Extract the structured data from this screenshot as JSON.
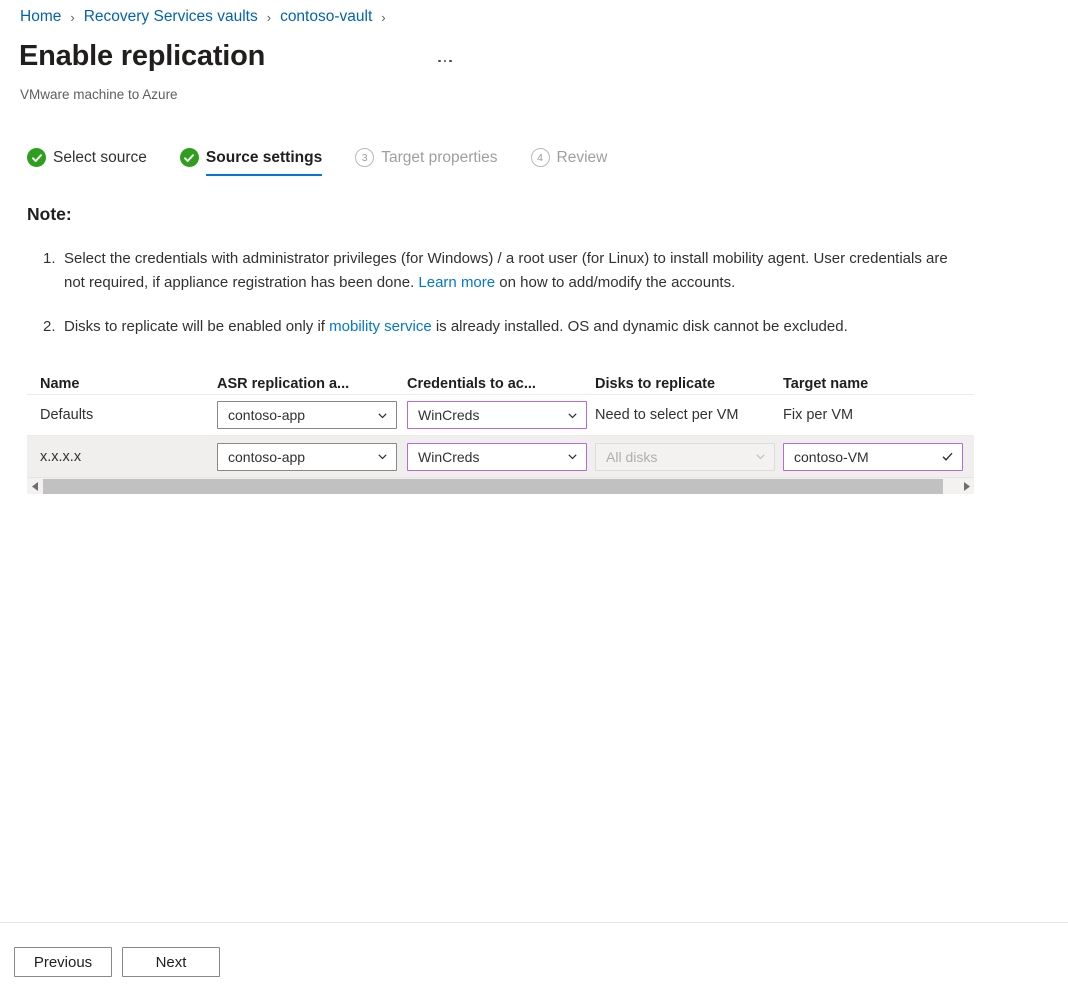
{
  "breadcrumb": {
    "items": [
      {
        "label": "Home"
      },
      {
        "label": "Recovery Services vaults"
      },
      {
        "label": "contoso-vault"
      }
    ],
    "separator": "›"
  },
  "header": {
    "title": "Enable replication",
    "subtitle": "VMware machine to Azure",
    "more_menu": "..."
  },
  "steps": [
    {
      "label": "Select source",
      "state": "done",
      "number": "1"
    },
    {
      "label": "Source settings",
      "state": "active",
      "number": "2"
    },
    {
      "label": "Target properties",
      "state": "todo",
      "number": "3"
    },
    {
      "label": "Review",
      "state": "todo",
      "number": "4"
    }
  ],
  "note": {
    "heading": "Note:",
    "items": [
      {
        "number": "1.",
        "text_before": "Select the credentials with administrator privileges (for Windows) / a root user (for Linux) to install mobility agent. User credentials are not required, if appliance registration has been done. ",
        "link": "Learn more",
        "text_after": " on how to add/modify the accounts."
      },
      {
        "number": "2.",
        "text_before": "Disks to replicate will be enabled only if ",
        "link": "mobility service",
        "text_after": " is already installed. OS and dynamic disk cannot be excluded."
      }
    ]
  },
  "table": {
    "columns": [
      {
        "key": "name",
        "label": "Name"
      },
      {
        "key": "asr",
        "label": "ASR replication a..."
      },
      {
        "key": "credentials",
        "label": "Credentials to ac..."
      },
      {
        "key": "disks",
        "label": "Disks to replicate"
      },
      {
        "key": "target",
        "label": "Target name"
      }
    ],
    "rows": {
      "defaults": {
        "name": "Defaults",
        "asr_value": "contoso-app",
        "credentials_value": "WinCreds",
        "disks_text": "Need to select per VM",
        "target_text": "Fix per VM"
      },
      "vm": {
        "name": "x.x.x.x",
        "asr_value": "contoso-app",
        "credentials_value": "WinCreds",
        "disks_value": "All disks",
        "target_value": "contoso-VM"
      }
    }
  },
  "footer": {
    "previous_label": "Previous",
    "next_label": "Next"
  },
  "colors": {
    "link": "#0078d4",
    "breadcrumb_link": "#0063b1",
    "step_done": "#2f9e1f",
    "accent_border": "#b36ae2",
    "active_underline": "#0078d4"
  }
}
